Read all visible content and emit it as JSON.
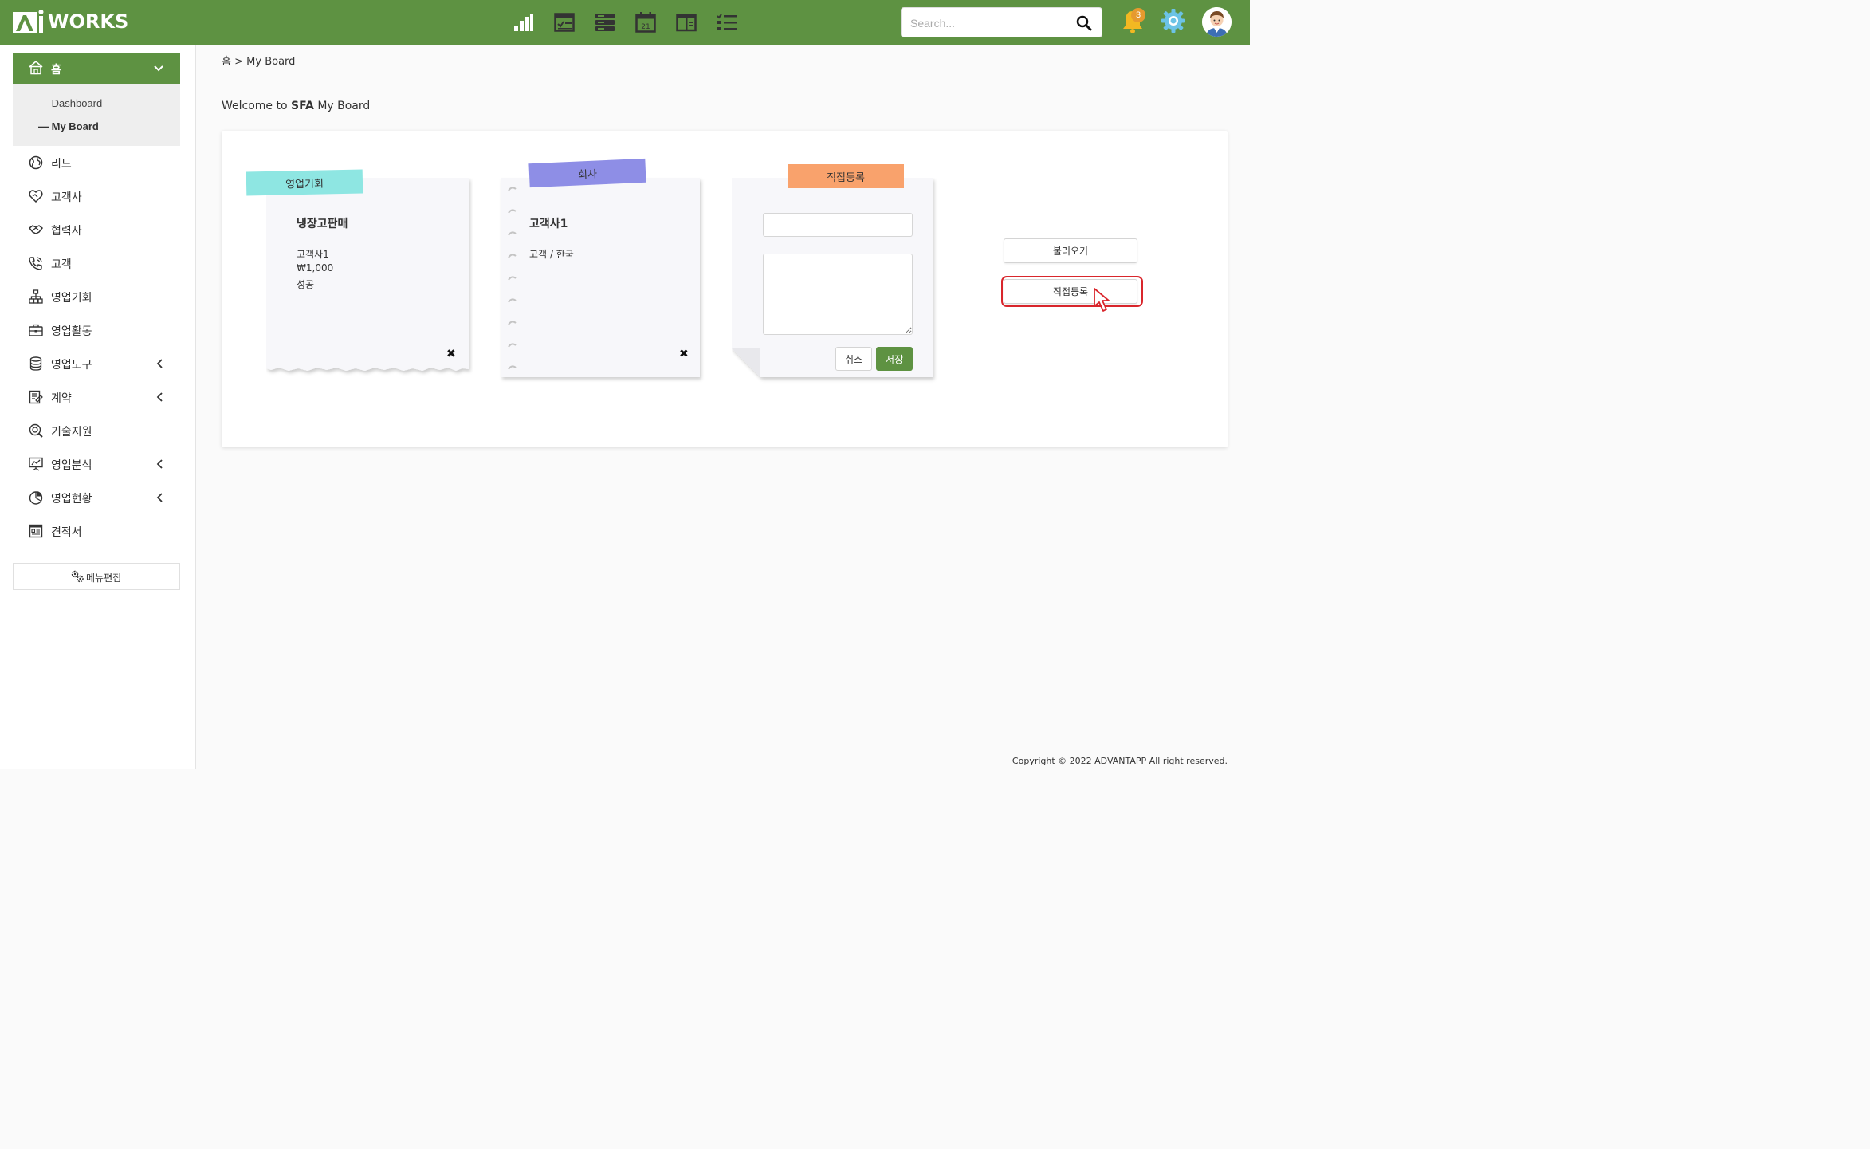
{
  "app": {
    "logo_text": "WORKS",
    "logo_mark": "Ai"
  },
  "header": {
    "icons": [
      "chart-bars-icon",
      "checklist-window-icon",
      "server-icon",
      "calendar-icon",
      "board-icon",
      "task-list-icon"
    ],
    "calendar_day": "21",
    "search": {
      "placeholder": "Search...",
      "value": ""
    },
    "notification_count": "3"
  },
  "sidebar": {
    "home": {
      "label": "홈"
    },
    "home_sub": [
      {
        "label": "Dashboard",
        "active": false
      },
      {
        "label": "My Board",
        "active": true
      }
    ],
    "items": [
      {
        "label": "리드",
        "icon": "globe-icon",
        "expandable": false
      },
      {
        "label": "고객사",
        "icon": "handshake-heart-icon",
        "expandable": false
      },
      {
        "label": "협력사",
        "icon": "handshake-icon",
        "expandable": false
      },
      {
        "label": "고객",
        "icon": "phone-icon",
        "expandable": false
      },
      {
        "label": "영업기회",
        "icon": "org-chart-icon",
        "expandable": false
      },
      {
        "label": "영업활동",
        "icon": "briefcase-icon",
        "expandable": false
      },
      {
        "label": "영업도구",
        "icon": "database-icon",
        "expandable": true
      },
      {
        "label": "계약",
        "icon": "contract-icon",
        "expandable": true
      },
      {
        "label": "기술지원",
        "icon": "support-search-icon",
        "expandable": false
      },
      {
        "label": "영업분석",
        "icon": "presentation-icon",
        "expandable": true
      },
      {
        "label": "영업현황",
        "icon": "pie-chart-icon",
        "expandable": true
      },
      {
        "label": "견적서",
        "icon": "quote-sheet-icon",
        "expandable": false
      }
    ],
    "menu_edit": {
      "label": "메뉴편집"
    }
  },
  "breadcrumb": {
    "home": "홈",
    "separator": ">",
    "current": "My Board"
  },
  "welcome": {
    "prefix": "Welcome to ",
    "bold": "SFA",
    "suffix": " My Board"
  },
  "board": {
    "notes": [
      {
        "tag": "영업기회",
        "title": "냉장고판매",
        "lines": [
          "고객사1",
          "₩1,000",
          "성공"
        ],
        "tag_color": "#8ee6e2"
      },
      {
        "tag": "회사",
        "title": "고객사1",
        "lines": [
          "고객 / 한국"
        ],
        "tag_color": "#8e8ee6"
      }
    ],
    "direct_form": {
      "tag": "직접등록",
      "tag_color": "#f9a26c",
      "title_value": "",
      "body_value": "",
      "cancel_label": "취소",
      "save_label": "저장"
    },
    "load_button": "불러오기",
    "direct_button": "직접등록"
  },
  "footer": {
    "copyright": "Copyright © 2022 ADVANTAPP All right reserved."
  },
  "colors": {
    "brand_green": "#5e9242",
    "highlight_red": "#d9262c",
    "badge_orange": "#e69a2e"
  }
}
